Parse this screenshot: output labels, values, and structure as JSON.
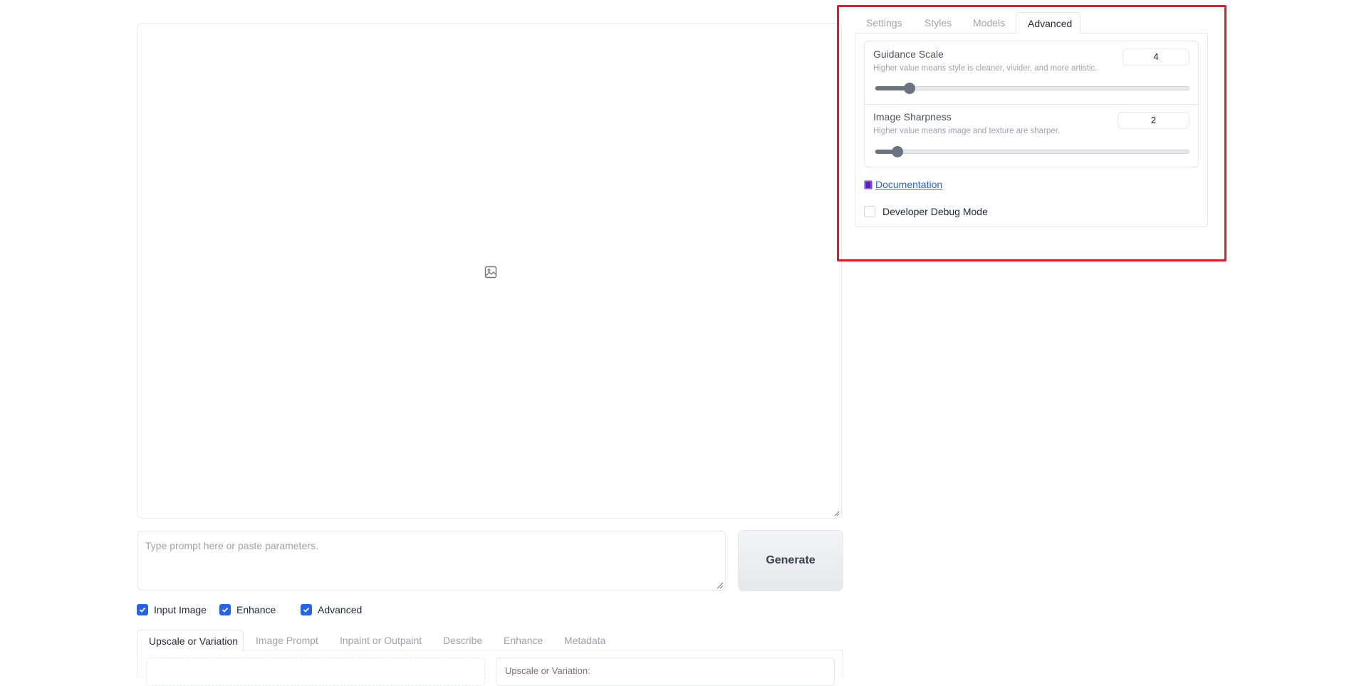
{
  "right_tabs": [
    "Settings",
    "Styles",
    "Models",
    "Advanced"
  ],
  "active_right_tab": "Advanced",
  "guidance_scale": {
    "label": "Guidance Scale",
    "info": "Higher value means style is cleaner, vivider, and more artistic.",
    "value": "4",
    "fraction": 0.11
  },
  "image_sharpness": {
    "label": "Image Sharpness",
    "info": "Higher value means image and texture are sharper.",
    "value": "2",
    "fraction": 0.07
  },
  "documentation": {
    "icon": "book-icon",
    "label": "Documentation"
  },
  "developer_debug": {
    "label": "Developer Debug Mode",
    "checked": false
  },
  "prompt": {
    "placeholder": "Type prompt here or paste parameters.",
    "value": ""
  },
  "generate_label": "Generate",
  "checkboxes": [
    {
      "label": "Input Image",
      "checked": true
    },
    {
      "label": "Enhance",
      "checked": true
    },
    {
      "label": "Advanced",
      "checked": true
    }
  ],
  "bottom_tabs": [
    "Upscale or Variation",
    "Image Prompt",
    "Inpaint or Outpaint",
    "Describe",
    "Enhance",
    "Metadata"
  ],
  "active_bottom_tab": "Upscale or Variation",
  "bottom_panel_right_label": "Upscale or Variation:",
  "colors": {
    "accent": "#2563eb",
    "highlight": "#e11d27"
  }
}
